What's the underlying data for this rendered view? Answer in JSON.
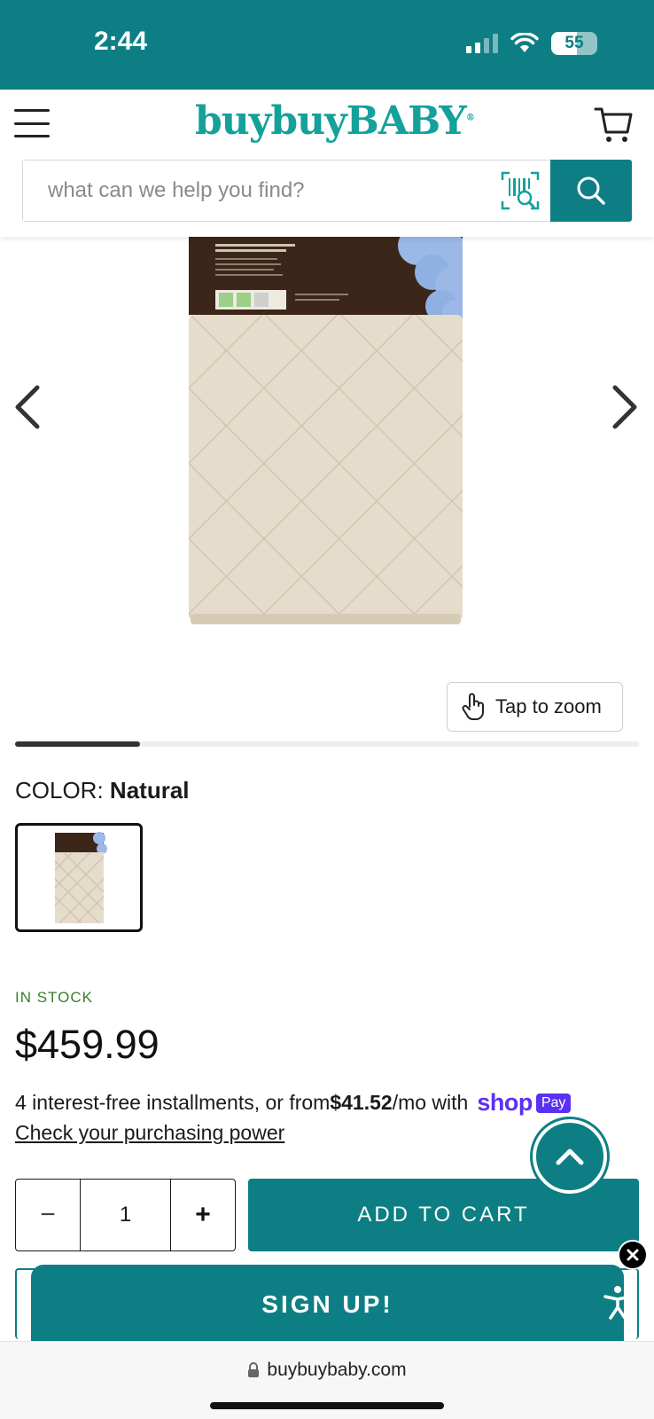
{
  "status_bar": {
    "time": "2:44",
    "battery": "55",
    "battery_level": 0.55
  },
  "header": {
    "logo": "buybuyBABY",
    "logo_mark": "®",
    "search_placeholder": "what can we help you find?"
  },
  "gallery": {
    "zoom_label": "Tap to zoom",
    "carousel_progress": 0.2
  },
  "product": {
    "color_label": "COLOR:",
    "color_value": "Natural",
    "stock": "IN STOCK",
    "price": "$459.99",
    "installments_prefix": "4 interest-free installments, or from ",
    "installments_amount": "$41.52",
    "installments_suffix": "/mo with",
    "shop_brand": "shop",
    "pay_badge": "Pay",
    "power_link": "Check your purchasing power"
  },
  "purchase": {
    "minus": "−",
    "quantity": "1",
    "plus": "+",
    "add_to_cart": "ADD TO CART"
  },
  "popup": {
    "signup": "SIGN UP!"
  },
  "browser": {
    "url": "buybuybaby.com"
  },
  "colors": {
    "brand_teal": "#0d7f84",
    "logo_teal": "#14a19a",
    "stock_green": "#3a7d2a",
    "shop_purple": "#5a31f4"
  },
  "icons": [
    "menu-icon",
    "cart-icon",
    "barcode-scan-icon",
    "search-icon",
    "chevron-left-icon",
    "chevron-right-icon",
    "touch-icon",
    "chevron-up-icon",
    "close-icon",
    "accessibility-icon",
    "lock-icon"
  ]
}
